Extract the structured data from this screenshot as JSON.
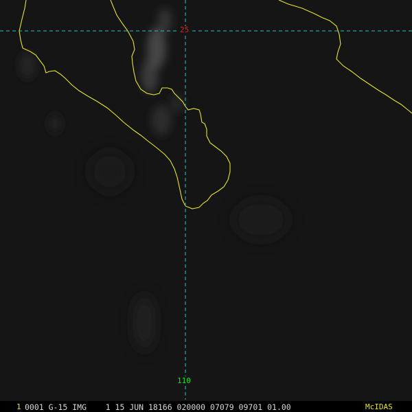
{
  "satellite_image": {
    "frame_number": "1",
    "header_text": "0001 G-15 IMG    1 15 JUN 18166 020000 07079 09701 01.00",
    "product_tag": "McIDAS",
    "grid": {
      "latitude_label": "25",
      "longitude_label": "110"
    },
    "colors": {
      "background": "#151515",
      "coastline": "#e6e62a",
      "grid_line": "#29c4c4",
      "latitude_label": "#e02020",
      "longitude_label": "#22e022",
      "header_text": "#d8d8d8"
    }
  }
}
